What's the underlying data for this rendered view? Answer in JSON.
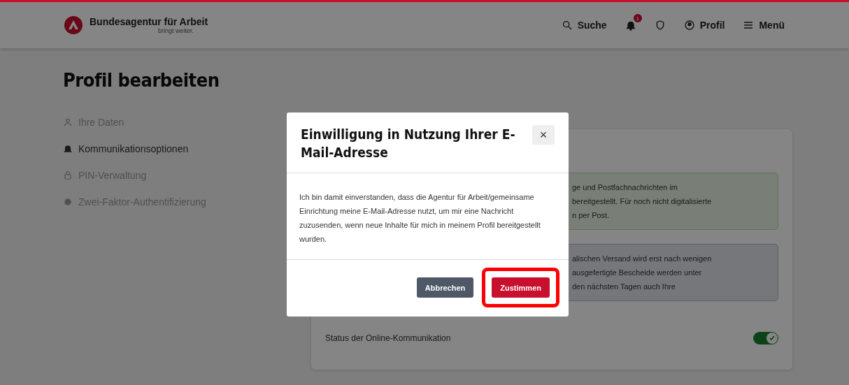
{
  "header": {
    "brand": "Bundesagentur für Arbeit",
    "tagline": "bringt weiter.",
    "nav": [
      {
        "kind": "search",
        "label": "Suche"
      },
      {
        "kind": "bell",
        "badge": "1"
      },
      {
        "kind": "shield"
      },
      {
        "kind": "profile",
        "label": "Profil"
      },
      {
        "kind": "menu",
        "label": "Menü"
      }
    ]
  },
  "page_title": "Profil bearbeiten",
  "sidebar": {
    "items": [
      {
        "label": "Ihre Daten",
        "selected": false
      },
      {
        "label": "Kommunikationsoptionen",
        "selected": true
      },
      {
        "label": "PIN-Verwaltung",
        "selected": false
      },
      {
        "label": "Zwei-Faktor-Authentifizierung",
        "selected": false
      }
    ]
  },
  "card": {
    "alerts": [
      {
        "kind": "success",
        "lines": [
          "ge und Postfachnachrichten im",
          "bereitgestellt. Für noch nicht digitalisierte",
          "n per Post."
        ]
      },
      {
        "kind": "info",
        "lines": [
          "alischen Versand wird erst nach wenigen",
          "ausgefertigte Bescheide werden unter",
          "den nächsten Tagen auch Ihre"
        ]
      }
    ],
    "status": {
      "label": "Status der Online-Kommunikation",
      "on": true
    }
  },
  "dialog": {
    "title": "Einwilligung in Nutzung Ihrer E-Mail-Adresse",
    "close": "×",
    "body": "Ich bin damit einverstanden, dass die Agentur für Arbeit/gemeinsame Einrichtung meine E-Mail-Adresse nutzt, um mir eine Nachricht zuzusenden, wenn neue Inhalte für mich in meinem Profil bereitgestellt wurden.",
    "buttons": [
      {
        "kind": "secondary",
        "label": "Abbrechen",
        "highlighted": false
      },
      {
        "kind": "primary",
        "label": "Zustimmen",
        "highlighted": true
      }
    ]
  }
}
